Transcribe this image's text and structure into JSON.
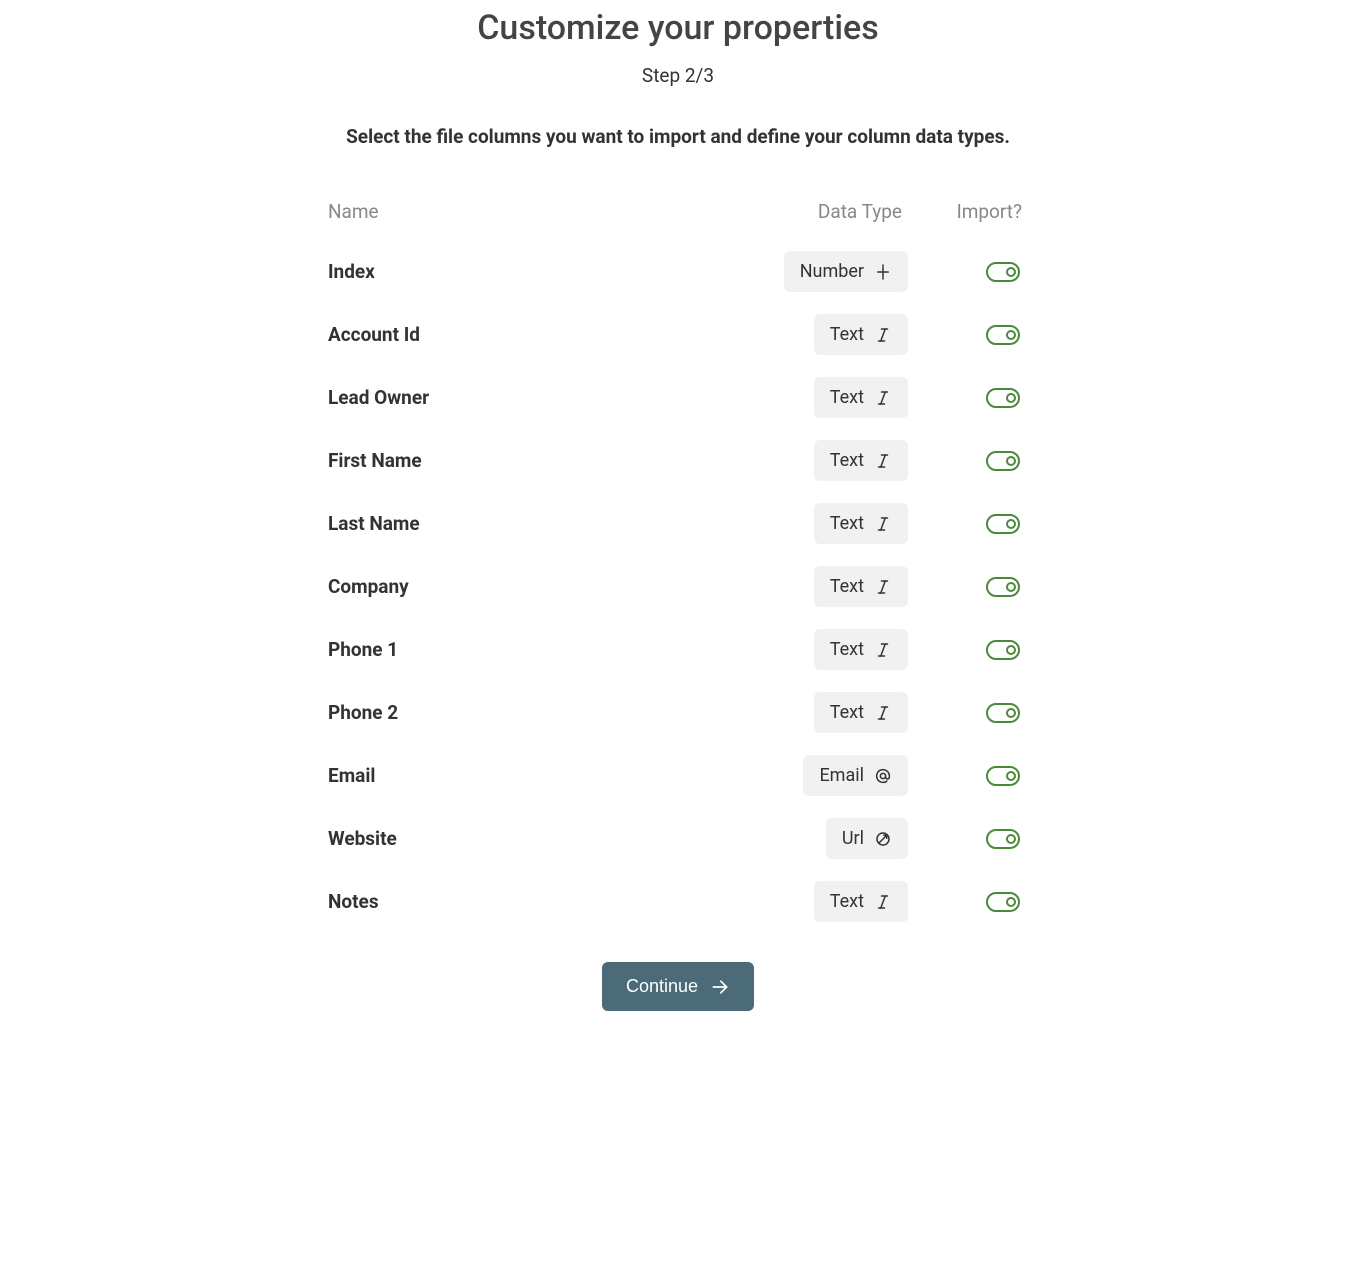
{
  "header": {
    "title": "Customize your properties",
    "step": "Step 2/3",
    "instructions": "Select the file columns you want to import and define your column data types."
  },
  "table": {
    "columns": {
      "name": "Name",
      "dataType": "Data Type",
      "import": "Import?"
    },
    "rows": [
      {
        "name": "Index",
        "type": "Number",
        "icon": "number",
        "import": true
      },
      {
        "name": "Account Id",
        "type": "Text",
        "icon": "text",
        "import": true
      },
      {
        "name": "Lead Owner",
        "type": "Text",
        "icon": "text",
        "import": true
      },
      {
        "name": "First Name",
        "type": "Text",
        "icon": "text",
        "import": true
      },
      {
        "name": "Last Name",
        "type": "Text",
        "icon": "text",
        "import": true
      },
      {
        "name": "Company",
        "type": "Text",
        "icon": "text",
        "import": true
      },
      {
        "name": "Phone 1",
        "type": "Text",
        "icon": "text",
        "import": true
      },
      {
        "name": "Phone 2",
        "type": "Text",
        "icon": "text",
        "import": true
      },
      {
        "name": "Email",
        "type": "Email",
        "icon": "email",
        "import": true
      },
      {
        "name": "Website",
        "type": "Url",
        "icon": "url",
        "import": true
      },
      {
        "name": "Notes",
        "type": "Text",
        "icon": "text",
        "import": true
      }
    ]
  },
  "footer": {
    "continue": "Continue"
  }
}
